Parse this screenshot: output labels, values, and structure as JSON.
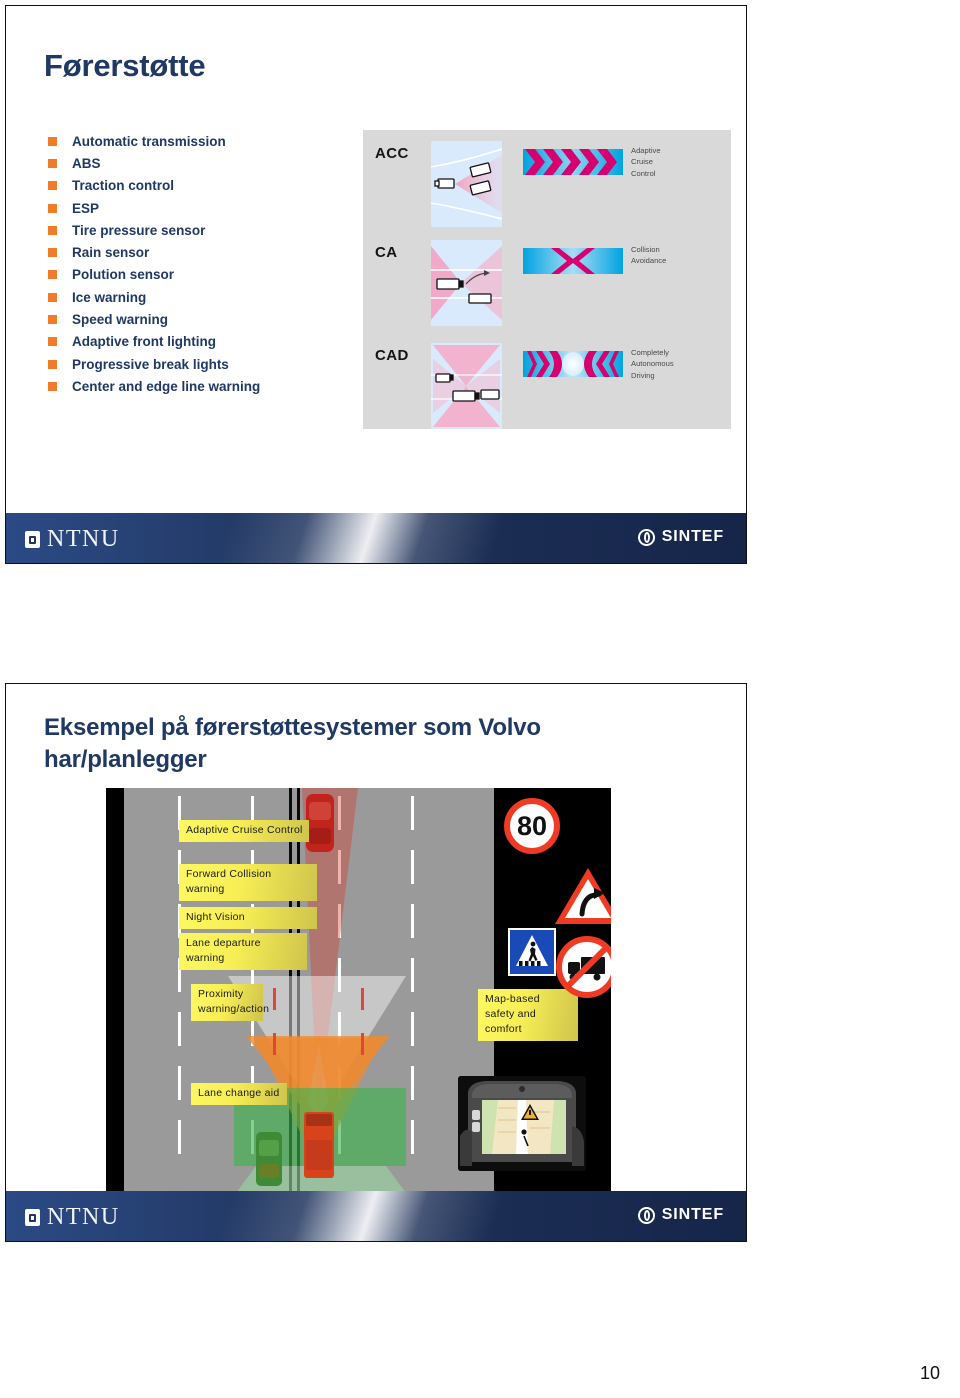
{
  "document": {
    "page_number": "10"
  },
  "slide1": {
    "title": "Førerstøtte",
    "bullets": [
      "Automatic transmission",
      "ABS",
      "Traction control",
      "ESP",
      "Tire pressure sensor",
      "Rain sensor",
      "Polution sensor",
      "Ice warning",
      "Speed warning",
      "Adaptive front lighting",
      "Progressive break lights",
      "Center and edge line warning"
    ],
    "diagram": {
      "rows": [
        {
          "code": "ACC",
          "caption": "Adaptive\nCruise\nControl",
          "caption_lines": [
            "Adaptive",
            "Cruise",
            "Control"
          ]
        },
        {
          "code": "CA",
          "caption": "Collision\nAvoidance",
          "caption_lines": [
            "Collision",
            "Avoidance"
          ]
        },
        {
          "code": "CAD",
          "caption": "Completely\nAutonomous\nDriving",
          "caption_lines": [
            "Completely",
            "Autonomous",
            "Driving"
          ]
        }
      ]
    },
    "footer": {
      "left_logo": "NTNU",
      "right_logo": "SINTEF"
    }
  },
  "slide2": {
    "title": "Eksempel på førerstøttesystemer som Volvo har/planlegger",
    "callouts": [
      "Adaptive Cruise Control",
      "Forward Collision warning",
      "Night Vision",
      "Lane departure warning",
      "Proximity warning/action",
      "Lane change aid",
      "Map-based safety and comfort"
    ],
    "signs": {
      "speed_limit": "80"
    },
    "footer": {
      "left_logo": "NTNU",
      "right_logo": "SINTEF"
    }
  },
  "colors": {
    "title_navy": "#1F3864",
    "bullet_orange": "#F07B28",
    "footer_blue": "#21365f",
    "callout_yellow": "#F7EE55",
    "sign_red": "#EF3B24",
    "sign_blue": "#1A49B8",
    "panel_gray": "#D9D9D9"
  }
}
